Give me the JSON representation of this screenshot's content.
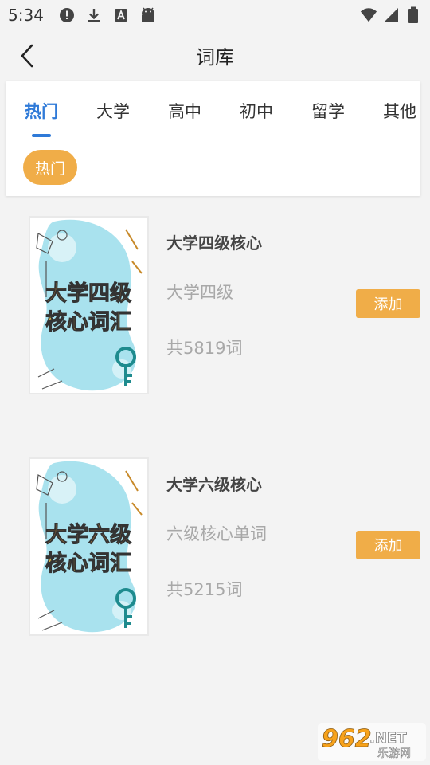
{
  "status_bar": {
    "time": "5:34",
    "left_icons": [
      "alert-icon",
      "download-icon",
      "a-square-icon",
      "android-icon"
    ],
    "right_icons": [
      "wifi-icon",
      "signal-icon",
      "battery-icon"
    ]
  },
  "app_bar": {
    "title": "词库",
    "back_icon": "chevron-left-icon"
  },
  "tabs": [
    {
      "label": "热门",
      "active": true
    },
    {
      "label": "大学"
    },
    {
      "label": "高中"
    },
    {
      "label": "初中"
    },
    {
      "label": "留学"
    },
    {
      "label": "其他"
    }
  ],
  "filter_chip": {
    "label": "热门"
  },
  "books": [
    {
      "title": "大学四级核心",
      "subtitle": "大学四级",
      "count": "共5819词",
      "button": "添加",
      "cover": {
        "line1": "大学四级",
        "line2": "核心词汇"
      }
    },
    {
      "title": "大学六级核心",
      "subtitle": "六级核心单词",
      "count": "共5215词",
      "button": "添加",
      "cover": {
        "line1": "大学六级",
        "line2": "核心词汇"
      }
    }
  ],
  "watermark": {
    "number": "962",
    "suffix": ".NET",
    "caption": "乐游网"
  },
  "colors": {
    "accent": "#2f7ad8",
    "orange": "#f0ad48",
    "background": "#f3f3f3",
    "muted": "#a8a8a8"
  }
}
